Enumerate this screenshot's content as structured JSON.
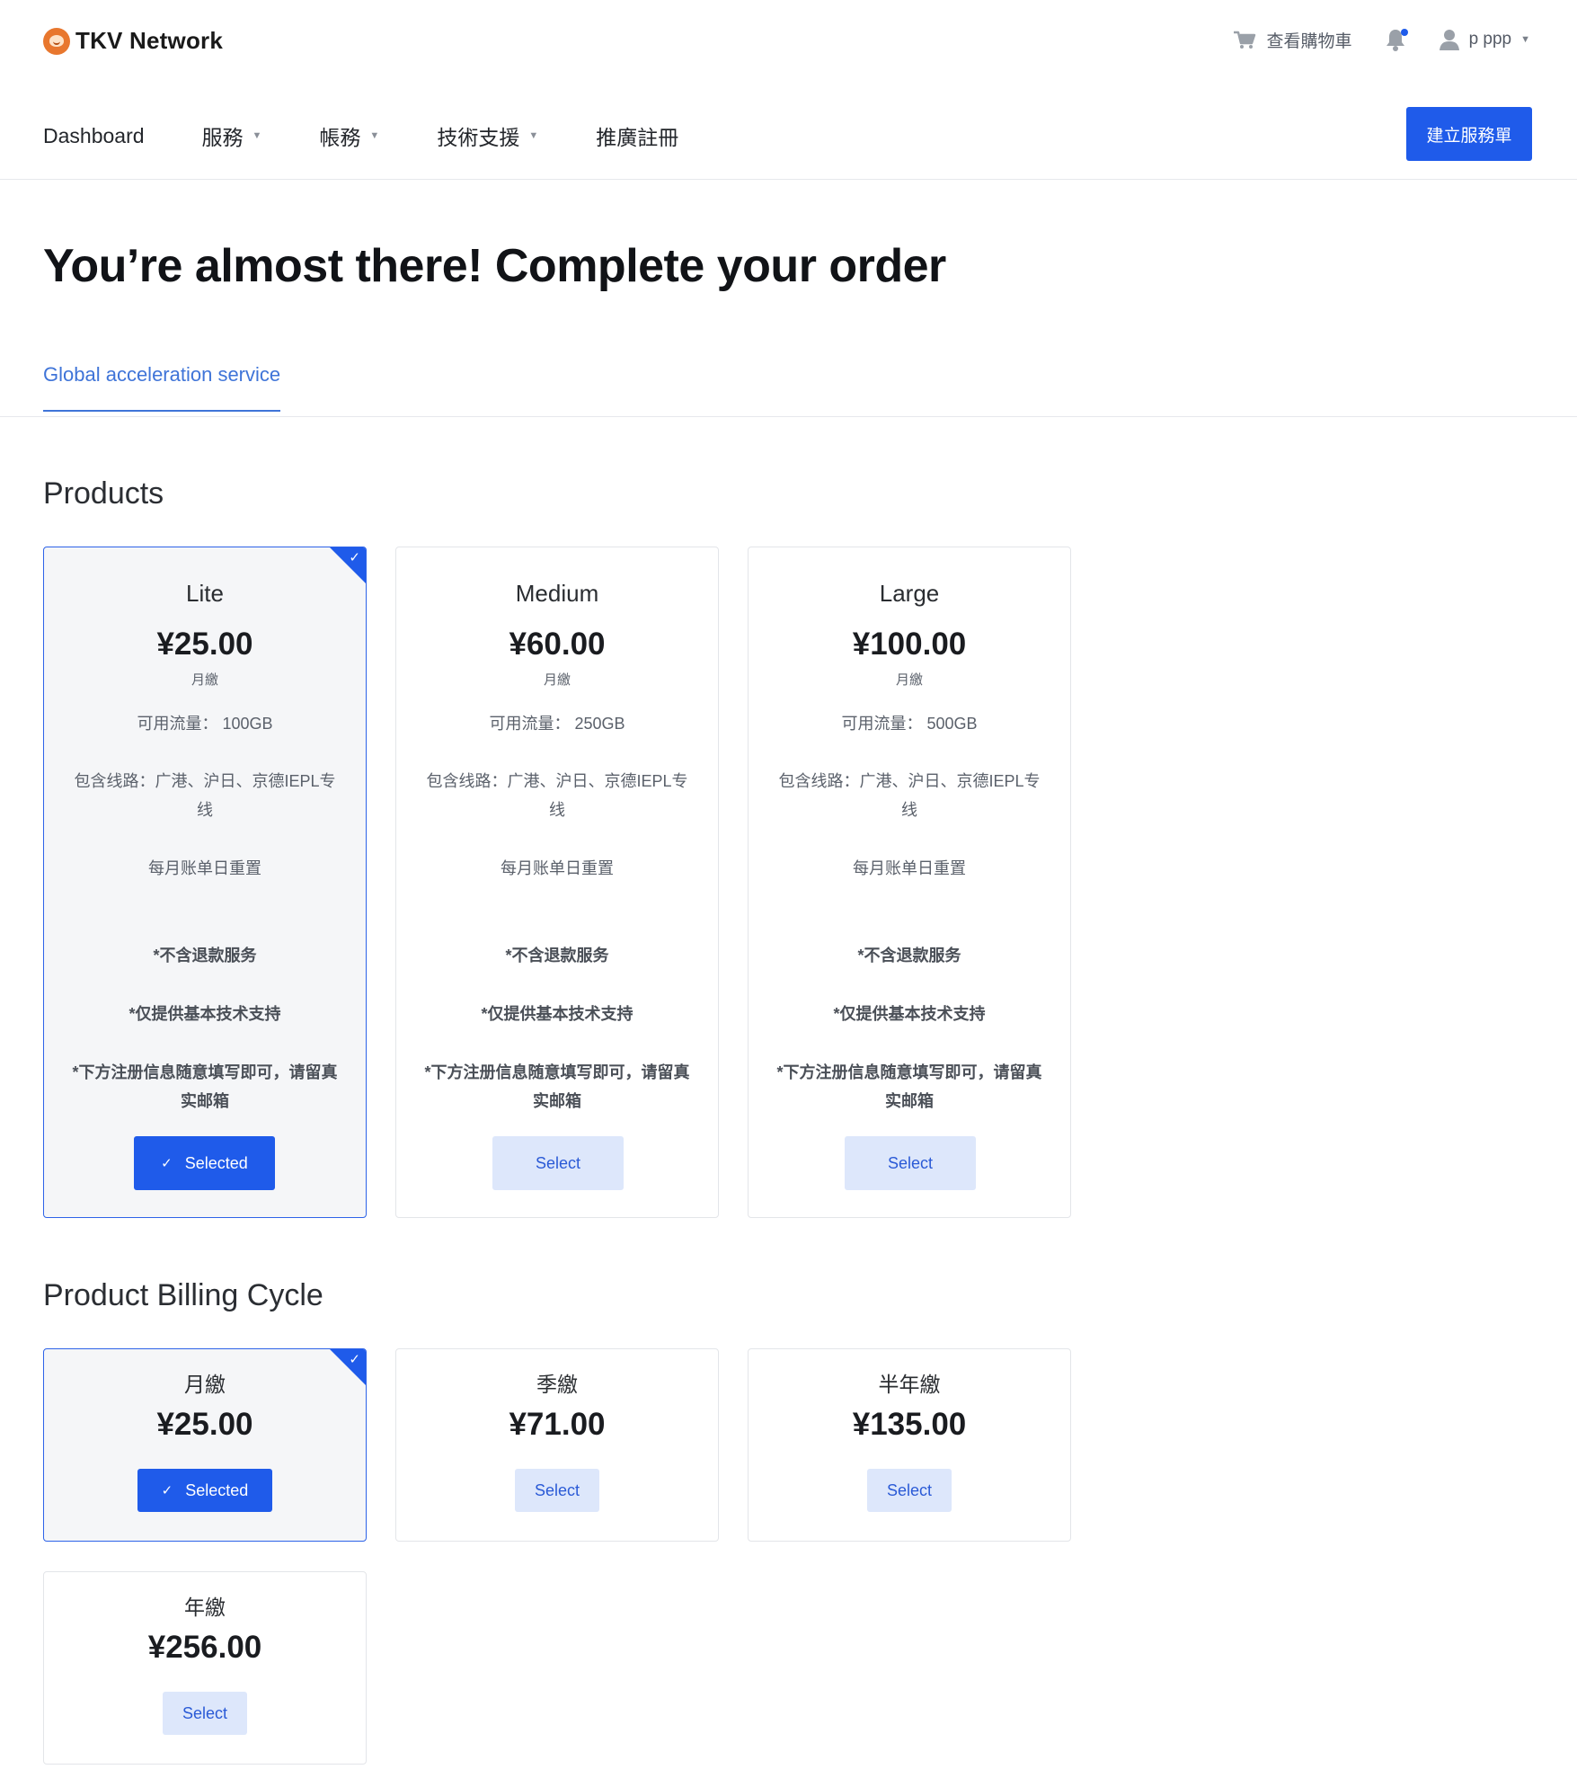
{
  "brand": {
    "name": "TKV Network"
  },
  "header": {
    "cart_label": "查看購物車",
    "user_name": "p ppp"
  },
  "nav": {
    "items": [
      {
        "label": "Dashboard",
        "has_dropdown": false
      },
      {
        "label": "服務",
        "has_dropdown": true
      },
      {
        "label": "帳務",
        "has_dropdown": true
      },
      {
        "label": "技術支援",
        "has_dropdown": true
      },
      {
        "label": "推廣註冊",
        "has_dropdown": false
      }
    ],
    "create_ticket_label": "建立服務單"
  },
  "page": {
    "title": "You’re almost there! Complete your order",
    "tab_active": "Global acceleration service"
  },
  "products": {
    "title": "Products",
    "items": [
      {
        "name": "Lite",
        "price": "¥25.00",
        "cycle": "月繳",
        "traffic": "可用流量： 100GB",
        "routes": "包含线路：广港、沪日、京德IEPL专线",
        "reset": "每月账单日重置",
        "note1": "*不含退款服务",
        "note2": "*仅提供基本技术支持",
        "note3": "*下方注册信息随意填写即可，请留真实邮箱",
        "selected": true,
        "button": "Selected"
      },
      {
        "name": "Medium",
        "price": "¥60.00",
        "cycle": "月繳",
        "traffic": "可用流量： 250GB",
        "routes": "包含线路：广港、沪日、京德IEPL专线",
        "reset": "每月账单日重置",
        "note1": "*不含退款服务",
        "note2": "*仅提供基本技术支持",
        "note3": "*下方注册信息随意填写即可，请留真实邮箱",
        "selected": false,
        "button": "Select"
      },
      {
        "name": "Large",
        "price": "¥100.00",
        "cycle": "月繳",
        "traffic": "可用流量： 500GB",
        "routes": "包含线路：广港、沪日、京德IEPL专线",
        "reset": "每月账单日重置",
        "note1": "*不含退款服务",
        "note2": "*仅提供基本技术支持",
        "note3": "*下方注册信息随意填写即可，请留真实邮箱",
        "selected": false,
        "button": "Select"
      }
    ]
  },
  "billing": {
    "title": "Product Billing Cycle",
    "items": [
      {
        "name": "月繳",
        "price": "¥25.00",
        "selected": true,
        "button": "Selected"
      },
      {
        "name": "季繳",
        "price": "¥71.00",
        "selected": false,
        "button": "Select"
      },
      {
        "name": "半年繳",
        "price": "¥135.00",
        "selected": false,
        "button": "Select"
      },
      {
        "name": "年繳",
        "price": "¥256.00",
        "selected": false,
        "button": "Select"
      }
    ]
  },
  "colors": {
    "accent": "#1f5bea",
    "tab": "#3f74d8",
    "select_bg": "#dde7fb"
  }
}
